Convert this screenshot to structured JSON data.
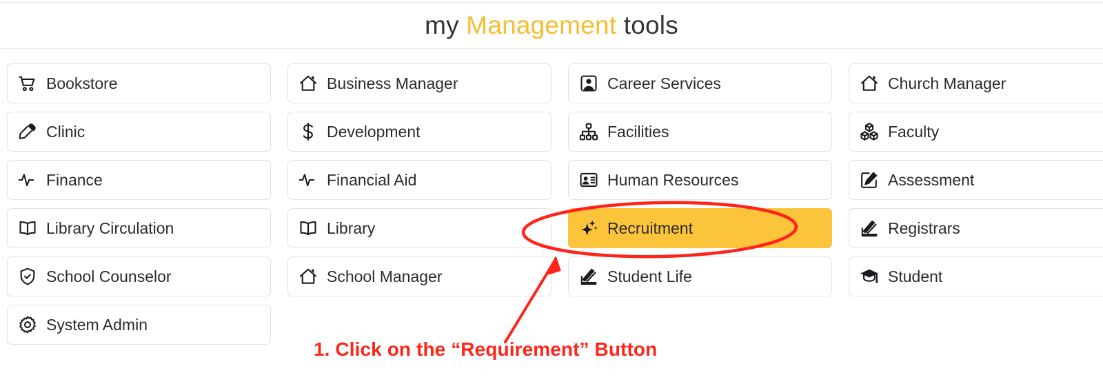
{
  "header": {
    "title_prefix": "my ",
    "title_accent": "Management",
    "title_suffix": " tools",
    "accent_color": "#f6bd33"
  },
  "grid": {
    "columns": [
      {
        "name": "column-1",
        "tiles": [
          {
            "label": "Bookstore",
            "icon": "shopping-cart-icon",
            "highlighted": false
          },
          {
            "label": "Clinic",
            "icon": "eyedropper-icon",
            "highlighted": false
          },
          {
            "label": "Finance",
            "icon": "pulse-activity-icon",
            "highlighted": false
          },
          {
            "label": "Library Circulation",
            "icon": "open-book-icon",
            "highlighted": false
          },
          {
            "label": "School Counselor",
            "icon": "shield-check-icon",
            "highlighted": false
          },
          {
            "label": "System Admin",
            "icon": "gear-icon",
            "highlighted": false
          }
        ]
      },
      {
        "name": "column-2",
        "tiles": [
          {
            "label": "Business Manager",
            "icon": "house-icon",
            "highlighted": false
          },
          {
            "label": "Development",
            "icon": "dollar-sign-icon",
            "highlighted": false
          },
          {
            "label": "Financial Aid",
            "icon": "pulse-activity-icon",
            "highlighted": false
          },
          {
            "label": "Library",
            "icon": "open-book-icon",
            "highlighted": false
          },
          {
            "label": "School Manager",
            "icon": "house-icon",
            "highlighted": false
          }
        ]
      },
      {
        "name": "column-3",
        "tiles": [
          {
            "label": "Career Services",
            "icon": "person-portrait-icon",
            "highlighted": false
          },
          {
            "label": "Facilities",
            "icon": "org-chart-icon",
            "highlighted": false
          },
          {
            "label": "Human Resources",
            "icon": "id-card-icon",
            "highlighted": false
          },
          {
            "label": "Recruitment",
            "icon": "sparkles-icon",
            "highlighted": true
          },
          {
            "label": "Student Life",
            "icon": "book-stack-icon",
            "highlighted": false
          }
        ]
      },
      {
        "name": "column-4",
        "tiles": [
          {
            "label": "Church Manager",
            "icon": "house-icon",
            "highlighted": false
          },
          {
            "label": "Faculty",
            "icon": "cubes-icon",
            "highlighted": false
          },
          {
            "label": "Assessment",
            "icon": "pencil-square-icon",
            "highlighted": false
          },
          {
            "label": "Registrars",
            "icon": "book-stack-icon",
            "highlighted": false
          },
          {
            "label": "Student",
            "icon": "graduation-cap-icon",
            "highlighted": false
          }
        ]
      }
    ]
  },
  "annotation": {
    "caption": "1. Click on the “Requirement” Button",
    "color": "#ff2419",
    "ellipse_target": "Recruitment",
    "highlight_color": "#fcc43a"
  }
}
